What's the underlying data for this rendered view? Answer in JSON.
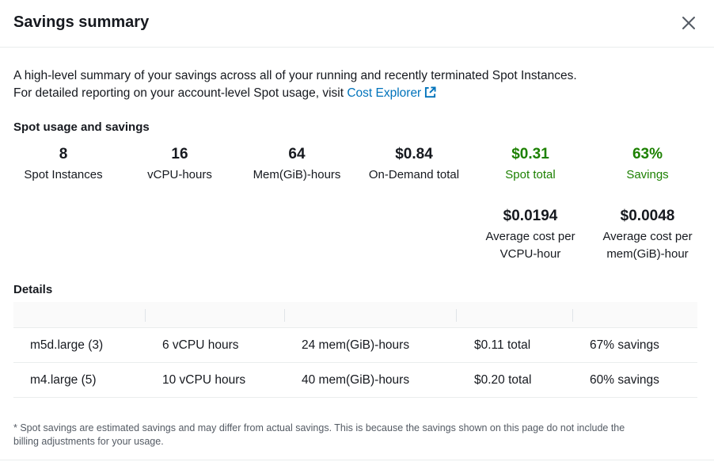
{
  "modal": {
    "title": "Savings summary",
    "close_label": "Close"
  },
  "intro": {
    "line1": "A high-level summary of your savings across all of your running and recently terminated Spot Instances.",
    "line2_prefix": "For detailed reporting on your account-level Spot usage, visit ",
    "link_text": "Cost Explorer"
  },
  "usage": {
    "heading": "Spot usage and savings",
    "stats": [
      {
        "value": "8",
        "label": "Spot Instances"
      },
      {
        "value": "16",
        "label": "vCPU-hours"
      },
      {
        "value": "64",
        "label": "Mem(GiB)-hours"
      },
      {
        "value": "$0.84",
        "label": "On-Demand total"
      },
      {
        "value": "$0.31",
        "label": "Spot total"
      },
      {
        "value": "63%",
        "label": "Savings"
      }
    ],
    "averages": [
      {
        "value": "$0.0194",
        "label_line1": "Average cost per",
        "label_line2": "VCPU-hour"
      },
      {
        "value": "$0.0048",
        "label_line1": "Average cost per",
        "label_line2": "mem(GiB)-hour"
      }
    ]
  },
  "details": {
    "heading": "Details",
    "rows": [
      {
        "instance": "m5d.large (3)",
        "vcpu": "6 vCPU hours",
        "mem": "24 mem(GiB)-hours",
        "total": "$0.11 total",
        "savings": "67% savings"
      },
      {
        "instance": "m4.large (5)",
        "vcpu": "10 vCPU hours",
        "mem": "40 mem(GiB)-hours",
        "total": "$0.20 total",
        "savings": "60% savings"
      }
    ]
  },
  "footnote": {
    "line1": "* Spot savings are estimated savings and may differ from actual savings. This is because the savings shown on this page do not include the",
    "line2": "billing adjustments for your usage."
  },
  "colors": {
    "accent_link": "#0073bb",
    "savings_green": "#1d8102",
    "text": "#16191f",
    "muted": "#545b64"
  },
  "icons": [
    "close-icon",
    "external-link-icon"
  ]
}
